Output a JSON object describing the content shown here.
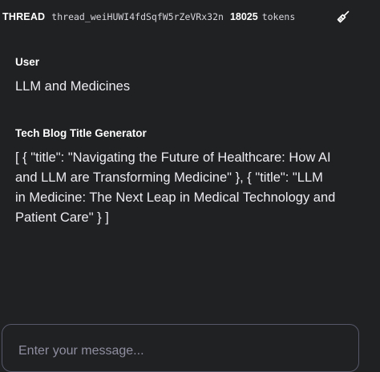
{
  "header": {
    "label": "THREAD",
    "thread_id": "thread_weiHUWI4fdSqfW5rZeVRx32n",
    "token_count": "18025",
    "token_unit": "tokens",
    "clean_icon": "broom-icon"
  },
  "messages": [
    {
      "role": "User",
      "content": "LLM and Medicines"
    },
    {
      "role": "Tech Blog Title Generator",
      "content": "[ { \"title\": \"Navigating the Future of Healthcare: How AI and LLM are Transforming Medicine\" }, { \"title\": \"LLM in Medicine: The Next Leap in Medical Technology and Patient Care\" } ]"
    }
  ],
  "composer": {
    "placeholder": "Enter your message..."
  },
  "colors": {
    "background": "#202123",
    "text": "#ececf1",
    "border": "#565869",
    "placeholder": "#8e8ea0"
  }
}
